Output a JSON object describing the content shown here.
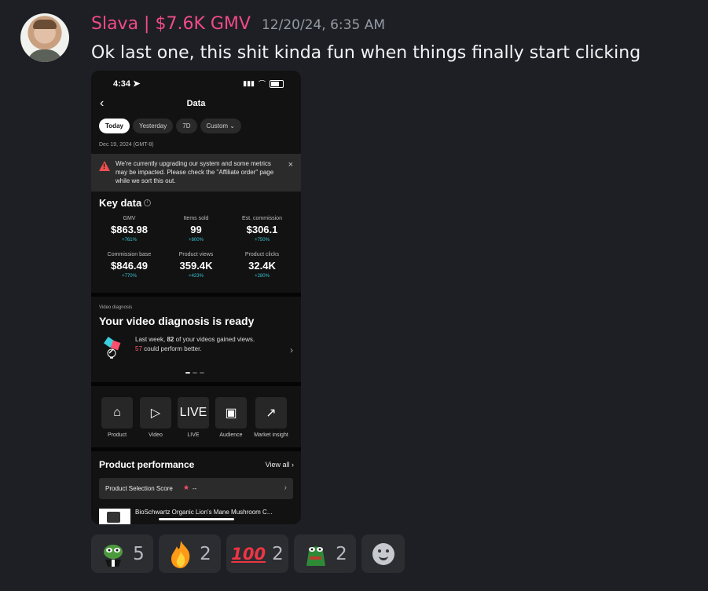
{
  "message": {
    "username": "Slava | $7.6K GMV",
    "timestamp": "12/20/24, 6:35 AM",
    "text": "Ok last one, this shit kinda fun when things finally start clicking"
  },
  "phone": {
    "time": "4:34",
    "title": "Data",
    "chips": [
      "Today",
      "Yesterday",
      "7D",
      "Custom ⌄"
    ],
    "date": "Dec 19, 2024 (GMT-8)",
    "notice": "We're currently upgrading our system and some metrics may be impacted. Please check the \"Affiliate order\" page while we sort this out.",
    "key_data_title": "Key data",
    "metrics": [
      {
        "label": "GMV",
        "value": "$863.98",
        "delta": "+761%"
      },
      {
        "label": "Items sold",
        "value": "99",
        "delta": "+800%"
      },
      {
        "label": "Est. commission",
        "value": "$306.1",
        "delta": "+750%"
      },
      {
        "label": "Commission base",
        "value": "$846.49",
        "delta": "+770%"
      },
      {
        "label": "Product views",
        "value": "359.4K",
        "delta": "+423%"
      },
      {
        "label": "Product clicks",
        "value": "32.4K",
        "delta": "+280%"
      }
    ],
    "video_diagnosis": {
      "label": "Video diagnosis",
      "title": "Your video diagnosis is ready",
      "text_1": "Last week,",
      "number": "82",
      "text_2": "of your videos gained views.",
      "number_red": "57",
      "text_3": "could perform better."
    },
    "tools": [
      "Product",
      "Video",
      "LIVE",
      "Audience",
      "Market insight"
    ],
    "product_performance": {
      "title": "Product performance",
      "view_all": "View all",
      "score_label": "Product Selection Score",
      "score_value": "--",
      "product_name": "BioSchwartz Organic Lion's Mane Mushroom C..."
    }
  },
  "reactions": [
    {
      "icon": "pepe-emoji",
      "count": "5"
    },
    {
      "icon": "fire-emoji",
      "count": "2"
    },
    {
      "icon": "hundred-emoji",
      "count": "2"
    },
    {
      "icon": "frog-emoji",
      "count": "2"
    }
  ]
}
